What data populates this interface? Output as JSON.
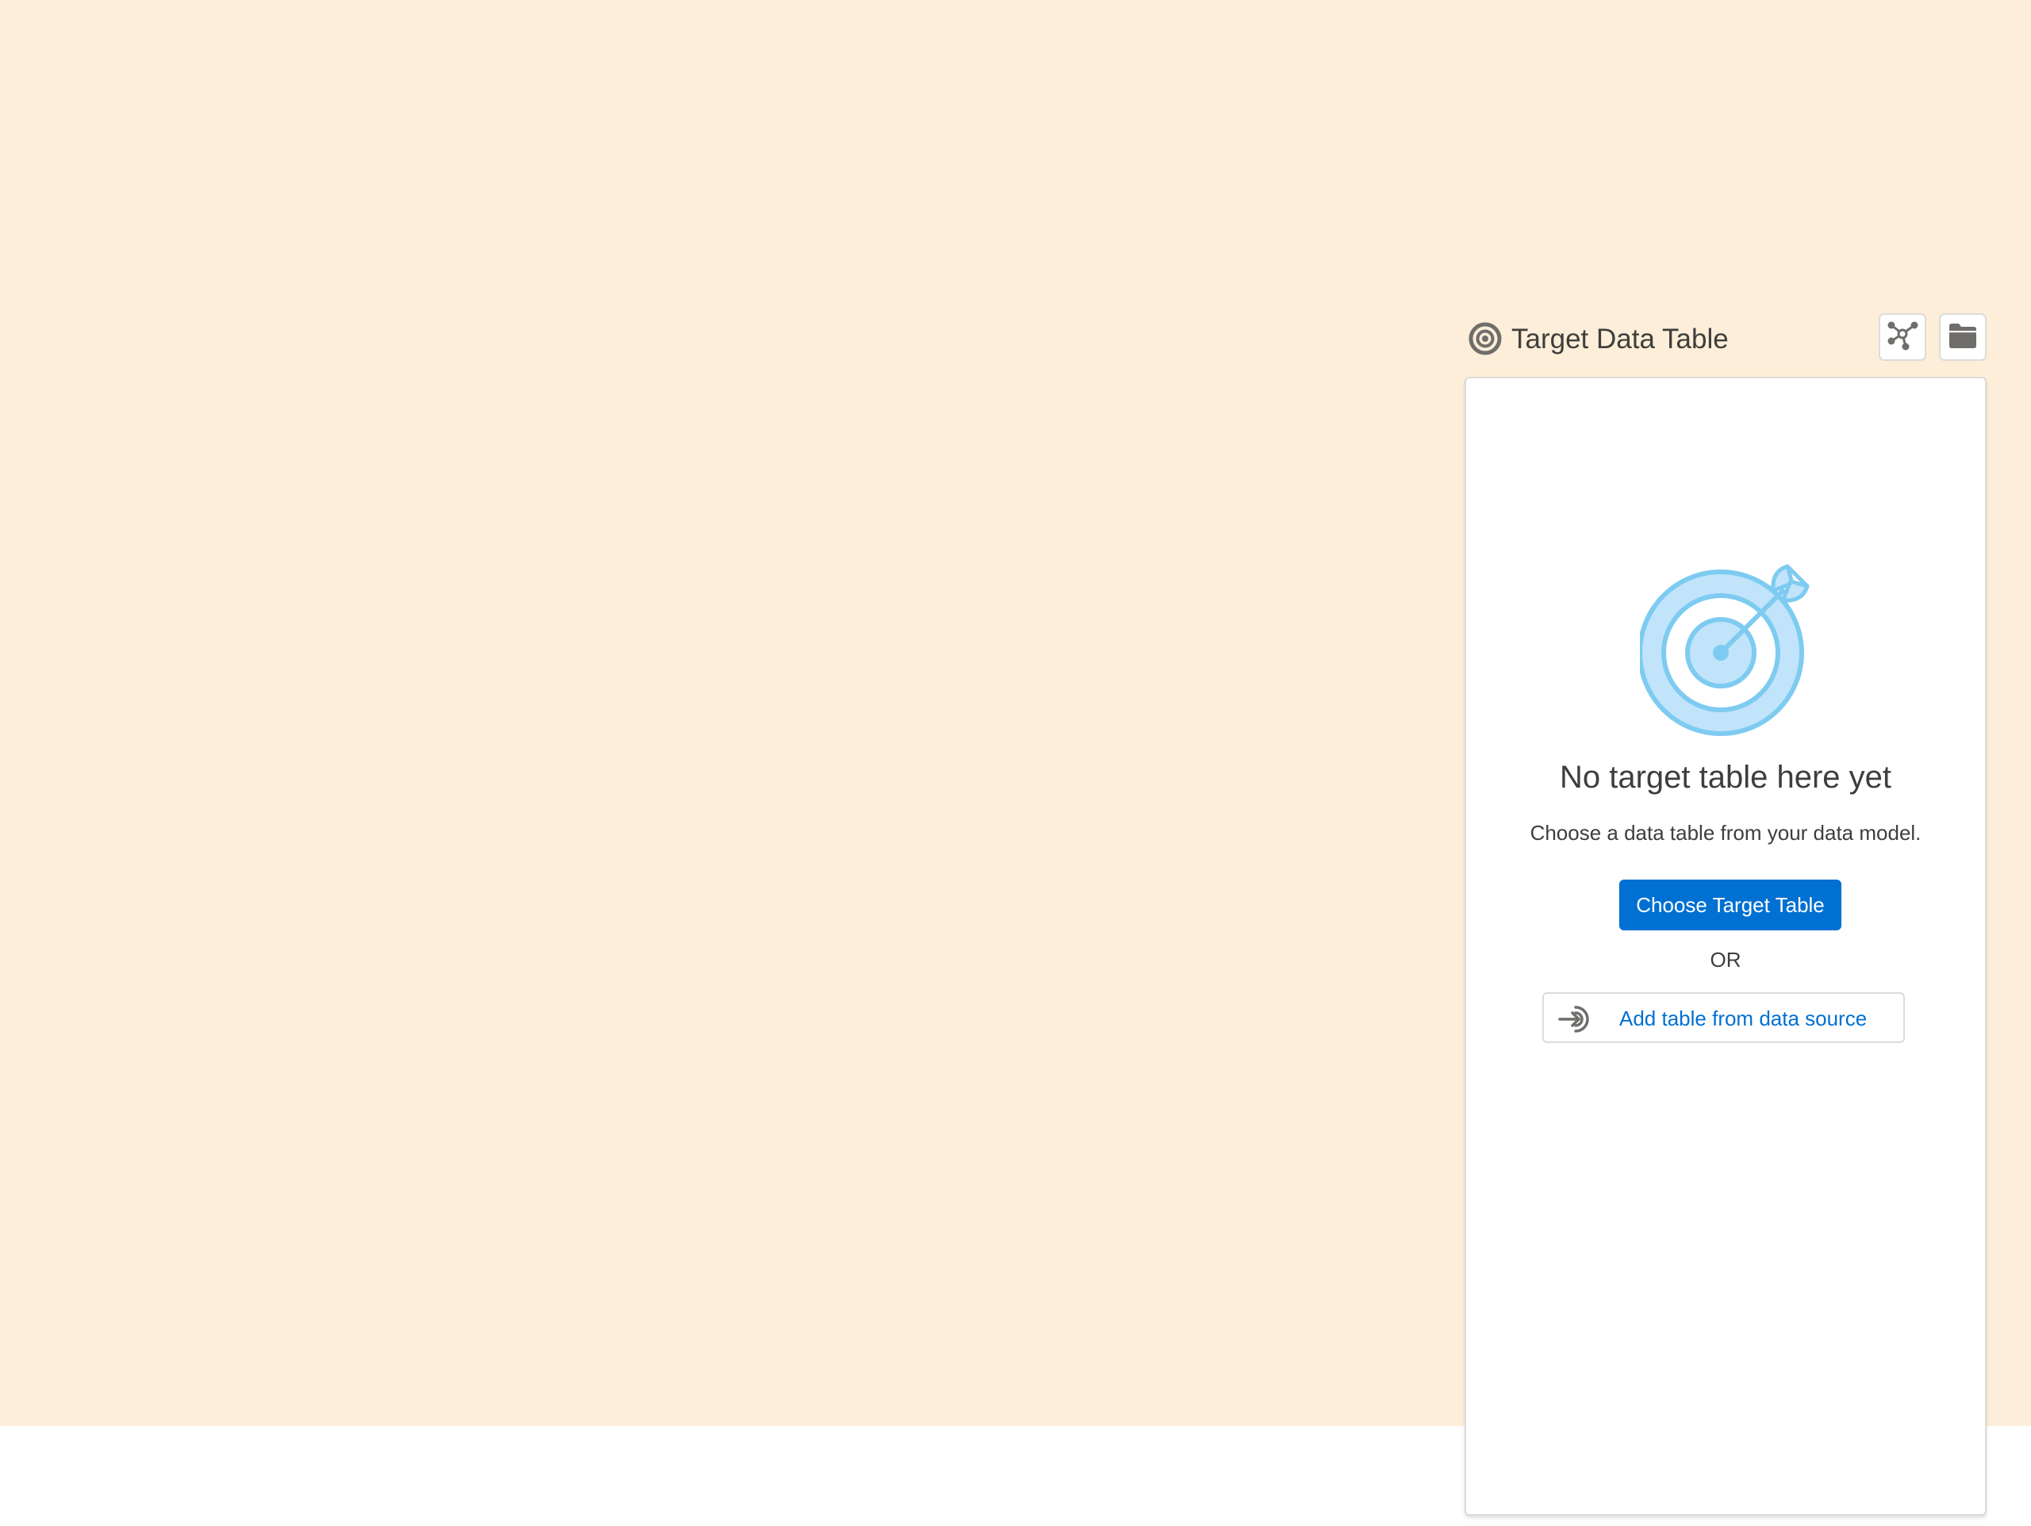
{
  "panel": {
    "title": "Target Data Table",
    "icons": {
      "header": "target-icon",
      "model_button": "data-model-icon",
      "folder_button": "folder-icon"
    }
  },
  "empty_state": {
    "illustration": "target-arrow-icon",
    "title": "No target table here yet",
    "subtitle": "Choose a data table from your data model.",
    "primary_button": "Choose Target Table",
    "separator": "OR",
    "secondary_button": {
      "label": "Add table from data source",
      "icon": "data-source-arrow-icon"
    }
  },
  "colors": {
    "canvas_background": "#fdeed9",
    "brand_blue": "#0070d2",
    "icon_gray": "#706e6b",
    "illustration_light_blue": "#c1e4fb",
    "illustration_blue": "#7ecbf1"
  }
}
